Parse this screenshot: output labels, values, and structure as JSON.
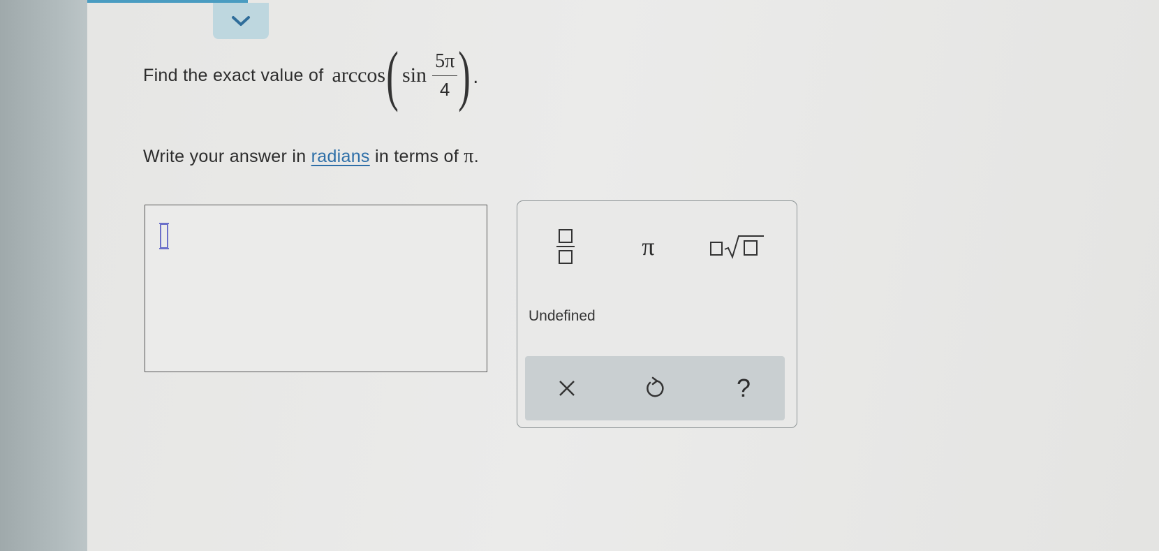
{
  "question": {
    "prompt": "Find the exact value of",
    "outer_function": "arccos",
    "inner_function": "sin",
    "numerator": "5π",
    "denominator": "4",
    "end_punctuation": "."
  },
  "instruction": {
    "before": "Write your answer in ",
    "link": "radians",
    "after": " in terms of ",
    "symbol": "π",
    "end": "."
  },
  "answer": {
    "value": ""
  },
  "keypad": {
    "pi_label": "π",
    "undefined_label": "Undefined",
    "help_label": "?"
  },
  "icons": {
    "collapse": "chevron-down-icon",
    "fraction": "fraction-template-icon",
    "root": "nth-root-template-icon",
    "clear": "close-icon",
    "undo": "undo-icon"
  },
  "colors": {
    "accent": "#2e6fa8",
    "tab": "#bed7df",
    "action_bar": "#c9cfd1",
    "cursor": "#6b6fc9"
  }
}
